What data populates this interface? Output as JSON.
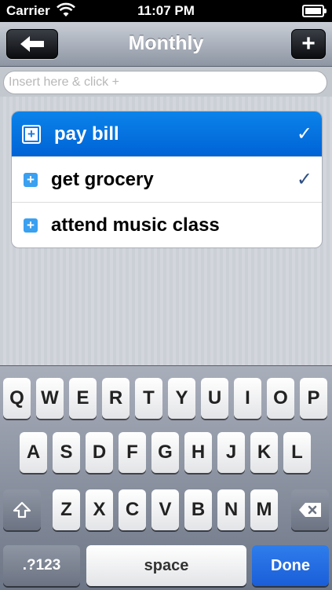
{
  "status_bar": {
    "carrier": "Carrier",
    "time": "11:07 PM"
  },
  "nav": {
    "title": "Monthly",
    "back_icon": "left-arrow-icon",
    "add_label": "+"
  },
  "input": {
    "placeholder": "Insert here & click +"
  },
  "tasks": [
    {
      "label": "pay bill",
      "checked": true,
      "selected": true
    },
    {
      "label": "get grocery",
      "checked": true,
      "selected": false
    },
    {
      "label": "attend music class",
      "checked": false,
      "selected": false
    }
  ],
  "check_mark": "✓",
  "plus_mark": "+",
  "keyboard": {
    "row1": [
      "Q",
      "W",
      "E",
      "R",
      "T",
      "Y",
      "U",
      "I",
      "O",
      "P"
    ],
    "row2": [
      "A",
      "S",
      "D",
      "F",
      "G",
      "H",
      "J",
      "K",
      "L"
    ],
    "row3": [
      "Z",
      "X",
      "C",
      "V",
      "B",
      "N",
      "M"
    ],
    "numbers_label": ".?123",
    "space_label": "space",
    "done_label": "Done"
  },
  "colors": {
    "selection_blue": "#0a74e2",
    "checkmark": "#2d4f84",
    "done_blue": "#2a6fe0"
  }
}
